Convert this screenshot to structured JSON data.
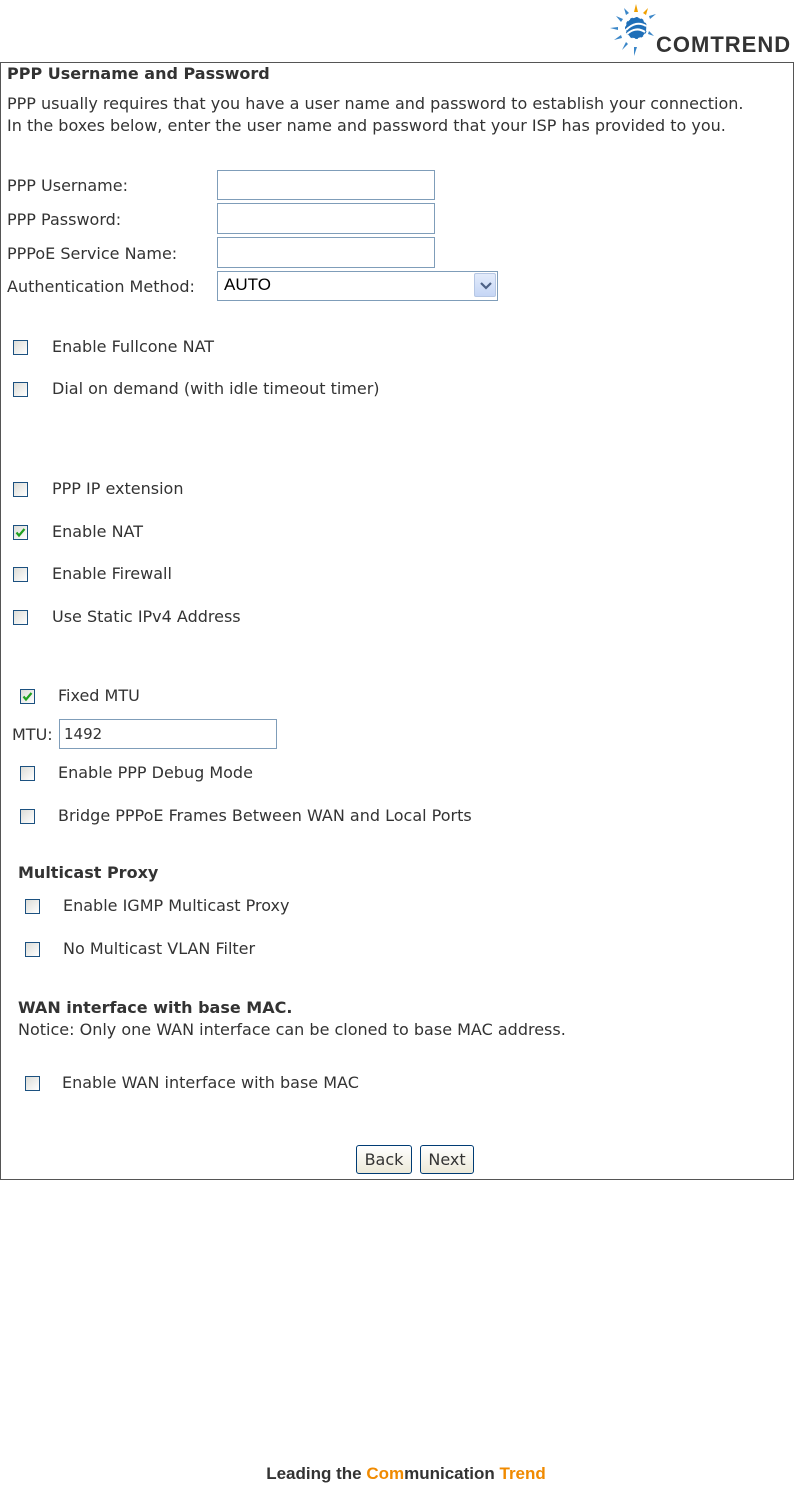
{
  "brand": {
    "name": "COMTREND",
    "accent": "#3a86c8"
  },
  "section_title": "PPP Username and Password",
  "intro": [
    "PPP usually requires that you have a user name and password to establish your connection.",
    "In the boxes below, enter the user name and password that your ISP has provided to you."
  ],
  "fields": {
    "username": {
      "label": "PPP Username:",
      "value": ""
    },
    "password": {
      "label": "PPP Password:",
      "value": ""
    },
    "service": {
      "label": "PPPoE Service Name:",
      "value": ""
    },
    "auth": {
      "label": "Authentication Method:",
      "value": "AUTO"
    }
  },
  "checkboxes": {
    "fullcone": {
      "label": "Enable Fullcone NAT",
      "checked": false
    },
    "dial": {
      "label": "Dial on demand (with idle timeout timer)",
      "checked": false
    },
    "ipext": {
      "label": "PPP IP extension",
      "checked": false
    },
    "nat": {
      "label": "Enable NAT",
      "checked": true
    },
    "firewall": {
      "label": "Enable Firewall",
      "checked": false
    },
    "staticip": {
      "label": "Use Static IPv4 Address",
      "checked": false
    },
    "fixedmtu": {
      "label": "Fixed MTU",
      "checked": true
    },
    "debug": {
      "label": "Enable PPP Debug Mode",
      "checked": false
    },
    "bridge": {
      "label": "Bridge PPPoE Frames Between WAN and Local Ports",
      "checked": false
    },
    "igmp": {
      "label": "Enable IGMP Multicast Proxy",
      "checked": false
    },
    "novlan": {
      "label": "No Multicast VLAN Filter",
      "checked": false
    },
    "wanmac": {
      "label": "Enable WAN interface with base MAC",
      "checked": false
    }
  },
  "mtu": {
    "label": "MTU:",
    "value": "1492"
  },
  "multicast_title": "Multicast Proxy",
  "wanmac_title": "WAN interface with base MAC.",
  "wanmac_notice": "Notice: Only one WAN interface can be cloned to base MAC address.",
  "buttons": {
    "back": "Back",
    "next": "Next"
  },
  "footer": {
    "part1": "Leading the ",
    "part2": "Com",
    "part3": "munication ",
    "part4": "Trend",
    "accent_color": "#f08a00"
  }
}
